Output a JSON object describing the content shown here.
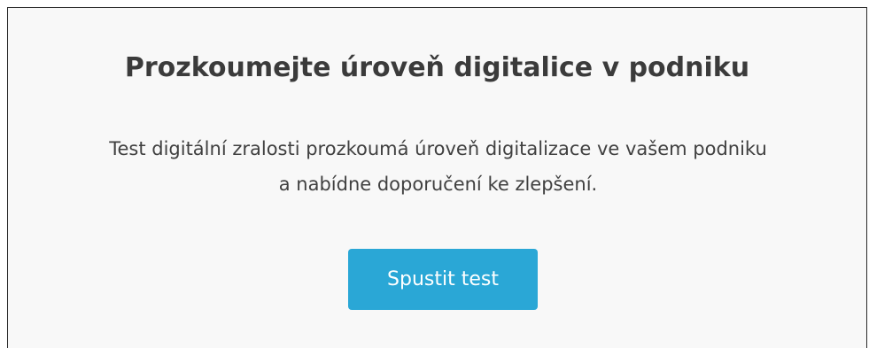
{
  "card": {
    "title": "Prozkoumejte úroveň digitalice v podniku",
    "description_line1": "Test digitální zralosti prozkoumá úroveň digitalizace ve vašem podniku",
    "description_line2": "a nabídne doporučení ke zlepšení.",
    "button_label": "Spustit test"
  },
  "colors": {
    "card_background": "#f8f8f8",
    "button_background": "#2aa7d6",
    "text": "#3b3b3b"
  }
}
